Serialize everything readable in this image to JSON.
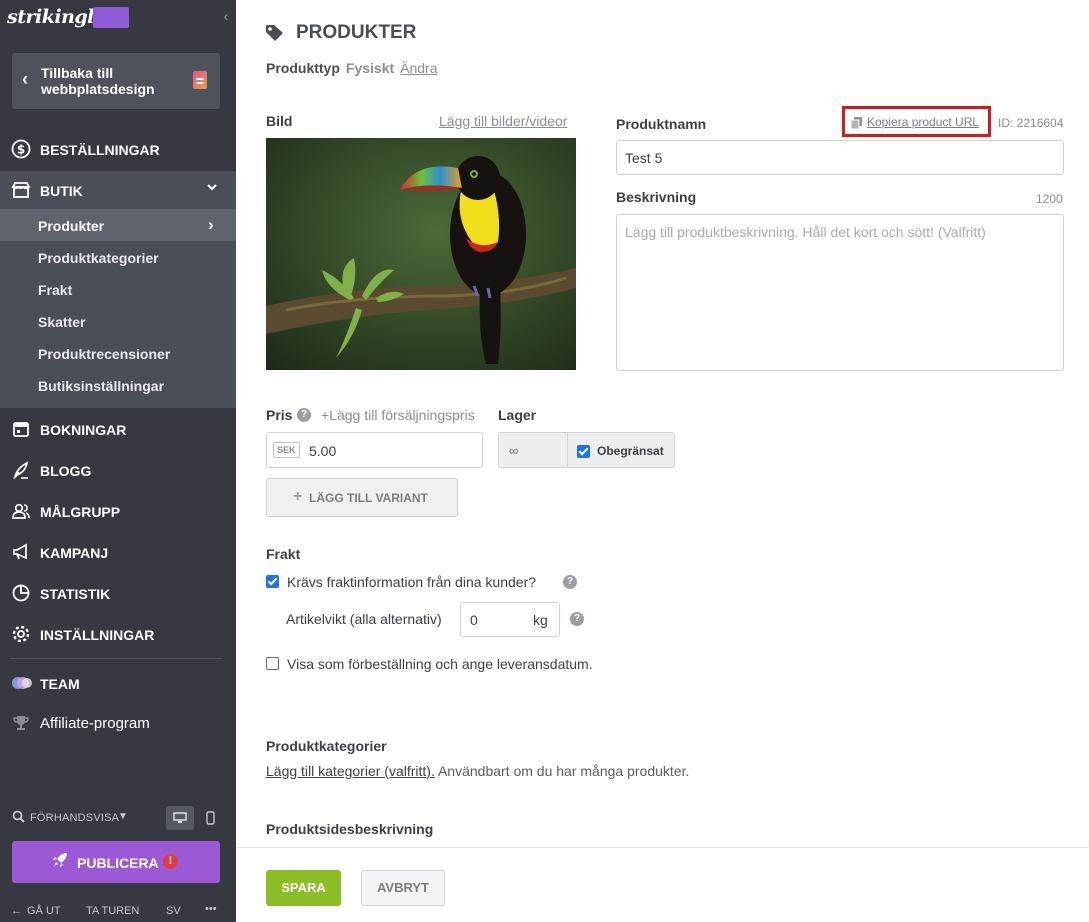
{
  "brand": {
    "logo_text": "strikingly",
    "accent": "#9b59d6"
  },
  "sidebar": {
    "back_label": "Tillbaka till webbplatsdesign",
    "nav": [
      {
        "label": "BESTÄLLNINGAR",
        "icon": "dollar-circle-icon"
      },
      {
        "label": "BUTIK",
        "icon": "store-icon"
      },
      {
        "label": "BOKNINGAR",
        "icon": "calendar-icon"
      },
      {
        "label": "BLOGG",
        "icon": "quill-icon"
      },
      {
        "label": "MÅLGRUPP",
        "icon": "users-icon"
      },
      {
        "label": "KAMPANJ",
        "icon": "megaphone-icon"
      },
      {
        "label": "STATISTIK",
        "icon": "pie-chart-icon"
      },
      {
        "label": "INSTÄLLNINGAR",
        "icon": "gear-icon"
      },
      {
        "label": "TEAM",
        "icon": "team-icon"
      },
      {
        "label": "Affiliate-program",
        "icon": "trophy-icon"
      }
    ],
    "store_sub": [
      {
        "label": "Produkter"
      },
      {
        "label": "Produktkategorier"
      },
      {
        "label": "Frakt"
      },
      {
        "label": "Skatter"
      },
      {
        "label": "Produktrecensioner"
      },
      {
        "label": "Butiksinställningar"
      }
    ],
    "preview_label": "FÖRHANDSVISA",
    "publish_label": "PUBLICERA",
    "publish_warning": "!",
    "bottom": {
      "exit": "GÅ UT",
      "tour": "TA TUREN",
      "lang": "SV",
      "more": "•••"
    }
  },
  "page": {
    "title": "PRODUKTER",
    "product_type_label": "Produkttyp",
    "product_type_value": "Fysiskt",
    "product_type_change": "Ändra"
  },
  "image_section": {
    "label": "Bild",
    "add_link": "Lägg till bilder/videor"
  },
  "name_section": {
    "label": "Produktnamn",
    "copy_url": "Kopiera product URL",
    "id_text": "ID: 2216604",
    "value": "Test 5"
  },
  "description": {
    "label": "Beskrivning",
    "counter": "1200",
    "placeholder": "Lägg till produktbeskrivning. Håll det kort och sött! (Valfritt)"
  },
  "price": {
    "label": "Pris",
    "help": "?",
    "add_sale": "+Lägg till försäljningspris",
    "currency": "SEK",
    "value": "5.00"
  },
  "stock": {
    "label": "Lager",
    "value": "∞",
    "unlimited_label": "Obegränsat",
    "unlimited_checked": true
  },
  "variant_button": "LÄGG TILL VARIANT",
  "shipping": {
    "title": "Frakt",
    "require_info": "Krävs fraktinformation från dina kunder?",
    "require_checked": true,
    "weight_label": "Artikelvikt (alla alternativ)",
    "weight_value": "0",
    "weight_unit": "kg",
    "preorder": "Visa som förbeställning och ange leveransdatum.",
    "preorder_checked": false
  },
  "categories": {
    "title": "Produktkategorier",
    "link": "Lägg till kategorier (valfritt).",
    "note": "Användbart om du har många produkter."
  },
  "product_page_desc": {
    "title": "Produktsidesbeskrivning"
  },
  "footer": {
    "save": "SPARA",
    "cancel": "AVBRYT"
  }
}
